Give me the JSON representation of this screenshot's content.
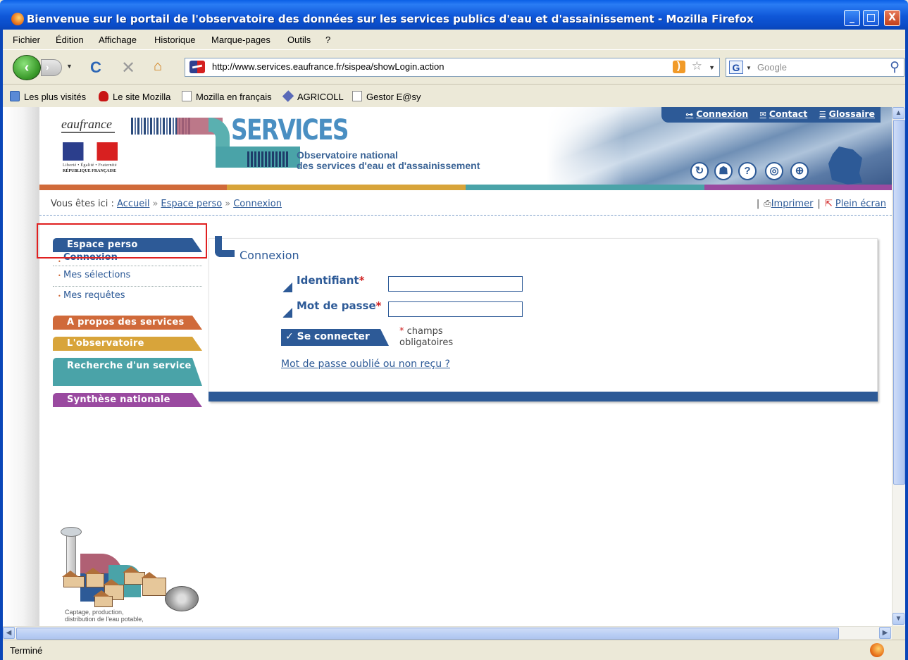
{
  "window": {
    "title": "Bienvenue sur le portail de l'observatoire des données sur les services publics d'eau et d'assainissement - Mozilla Firefox",
    "minimize": "_",
    "maximize": "□",
    "close": "X"
  },
  "menubar": {
    "items": [
      "Fichier",
      "Édition",
      "Affichage",
      "Historique",
      "Marque-pages",
      "Outils",
      "?"
    ]
  },
  "toolbar": {
    "back_glyph": "‹",
    "forward_glyph": "›",
    "reload_glyph": "C",
    "stop_glyph": "✕",
    "home_glyph": "⌂",
    "url": "http://www.services.eaufrance.fr/sispea/showLogin.action",
    "search_engine_letter": "G",
    "search_placeholder": "Google"
  },
  "bookmarks": {
    "items": [
      "Les plus visités",
      "Le site Mozilla",
      "Mozilla en français",
      "AGRICOLL",
      "Gestor E@sy"
    ]
  },
  "site_header": {
    "eaufrance": "eaufrance",
    "rf_motto": "Liberté • Égalité • Fraternité",
    "rf_name": "RÉPUBLIQUE FRANÇAISE",
    "services": "SERVICES",
    "obs_line1": "Observatoire national",
    "obs_line2": "des services d'eau et d'assainissement",
    "toplinks": {
      "connexion": "Connexion",
      "contact": "Contact",
      "glossaire": "Glossaire"
    }
  },
  "breadcrumb": {
    "prefix": "Vous êtes ici :",
    "items": [
      "Accueil",
      "Espace perso",
      "Connexion"
    ],
    "separator": "»",
    "print": "Imprimer",
    "fullscreen": "Plein écran"
  },
  "leftnav": {
    "espace_perso": "Espace perso",
    "sub_items": [
      "Connexion",
      "Mes sélections",
      "Mes requêtes"
    ],
    "a_propos": "A propos des services",
    "observatoire": "L'observatoire",
    "recherche": "Recherche d'un service",
    "synthese": "Synthèse nationale"
  },
  "login": {
    "title": "Connexion",
    "identifiant_label": "Identifiant",
    "password_label": "Mot de passe",
    "required_star": "*",
    "identifiant_value": "",
    "password_value": "",
    "submit": "Se connecter",
    "required_note_1": "champs",
    "required_note_2": "obligatoires",
    "forgot": "Mot de passe oublié ou non reçu ?"
  },
  "illustration": {
    "caption_1": "Captage, production,",
    "caption_2": "distribution de l'eau potable,"
  },
  "statusbar": {
    "text": "Terminé"
  },
  "colors": {
    "site_blue": "#2d5a97",
    "orange": "#d06a3a",
    "gold": "#d8a43a",
    "teal": "#4aa3a8",
    "purple": "#9a4aa0"
  }
}
